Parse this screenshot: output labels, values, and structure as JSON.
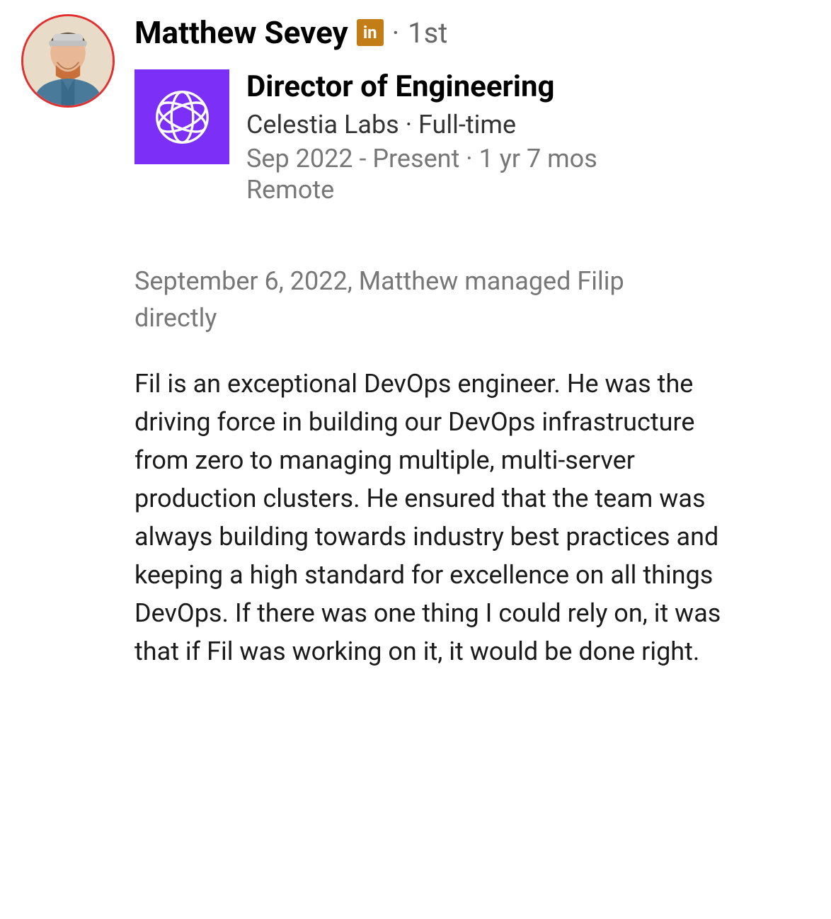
{
  "recommender": {
    "name": "Matthew Sevey",
    "connection_degree": "1st",
    "linkedin_badge_label": "in"
  },
  "position": {
    "title": "Director of Engineering",
    "company": "Celestia Labs",
    "employment_type": "Full-time",
    "date_range": "Sep 2022 - Present",
    "duration": "1 yr 7 mos",
    "location": "Remote"
  },
  "relationship": {
    "context": "September 6, 2022, Matthew managed Filip directly"
  },
  "recommendation": {
    "body": "Fil is an exceptional DevOps engineer. He was the driving force in building our DevOps infrastructure from zero to managing multiple, multi-server production clusters. He ensured that the team was always building towards industry best practices and keeping a high standard for excellence on all things DevOps. If there was one thing I could rely on, it was that if Fil was working on it, it would be done right."
  },
  "separators": {
    "dot": "·"
  }
}
